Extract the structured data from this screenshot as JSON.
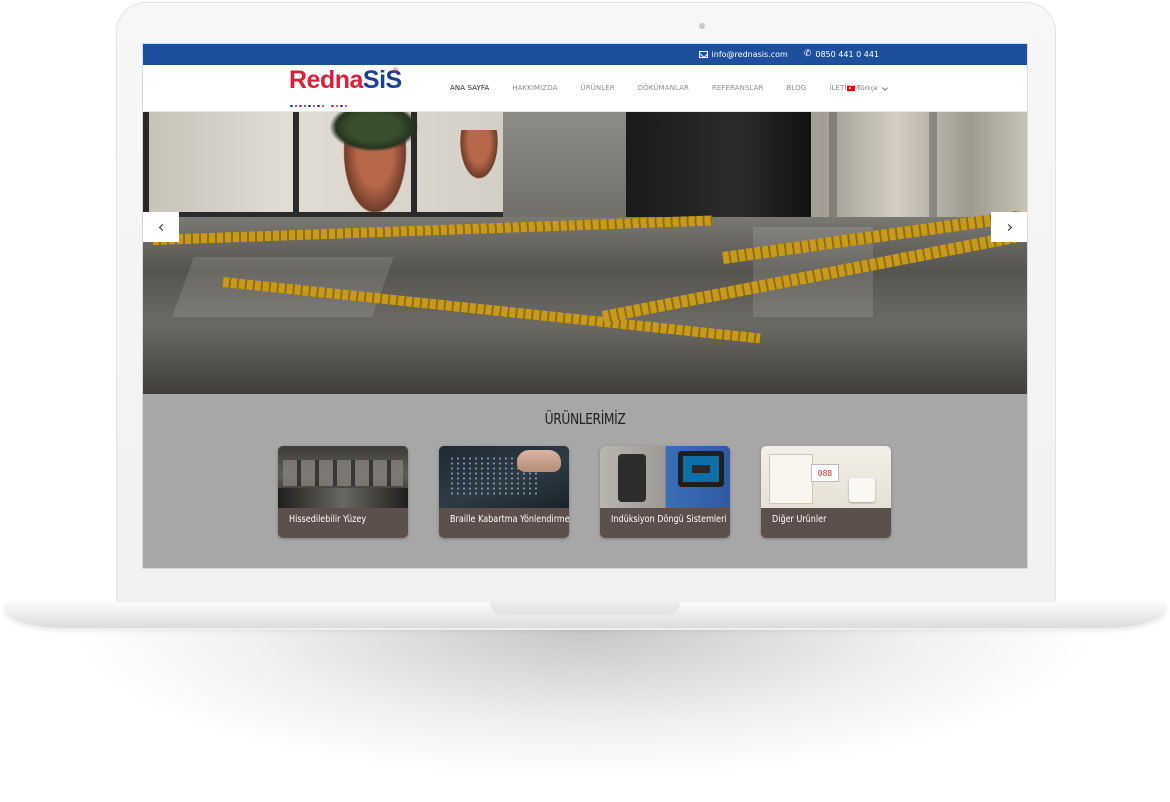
{
  "topbar": {
    "email": "info@rednasis.com",
    "phone": "0850 441 0 441",
    "email_icon": "envelope-icon",
    "phone_icon": "phone-icon"
  },
  "logo": {
    "part1": "Redna",
    "part2": "SiS",
    "reg": "®"
  },
  "nav": {
    "items": [
      "ANA SAYFA",
      "HAKKIMIZDA",
      "ÜRÜNLER",
      "DÖKÜMANLAR",
      "REFERANSLAR",
      "BLOG",
      "İLETİŞİM"
    ]
  },
  "language": {
    "label": "Türkçe",
    "flag_icon": "turkey-flag-icon"
  },
  "colors": {
    "topbar": "#1d4f9c",
    "logo_red": "#d8203a",
    "logo_blue": "#1d3f95",
    "products_bg": "#a7a7a7",
    "card_bg": "#5c504c"
  },
  "products": {
    "title": "ÜRÜNLERİMİZ",
    "cards": [
      {
        "label": "Hissedilebilir Yüzey"
      },
      {
        "label": "Braille Kabartma Yönlendirme"
      },
      {
        "label": "İndüksiyon Döngü Sistemleri"
      },
      {
        "label": "Diğer Ürünler"
      }
    ],
    "display_digits": "088"
  }
}
